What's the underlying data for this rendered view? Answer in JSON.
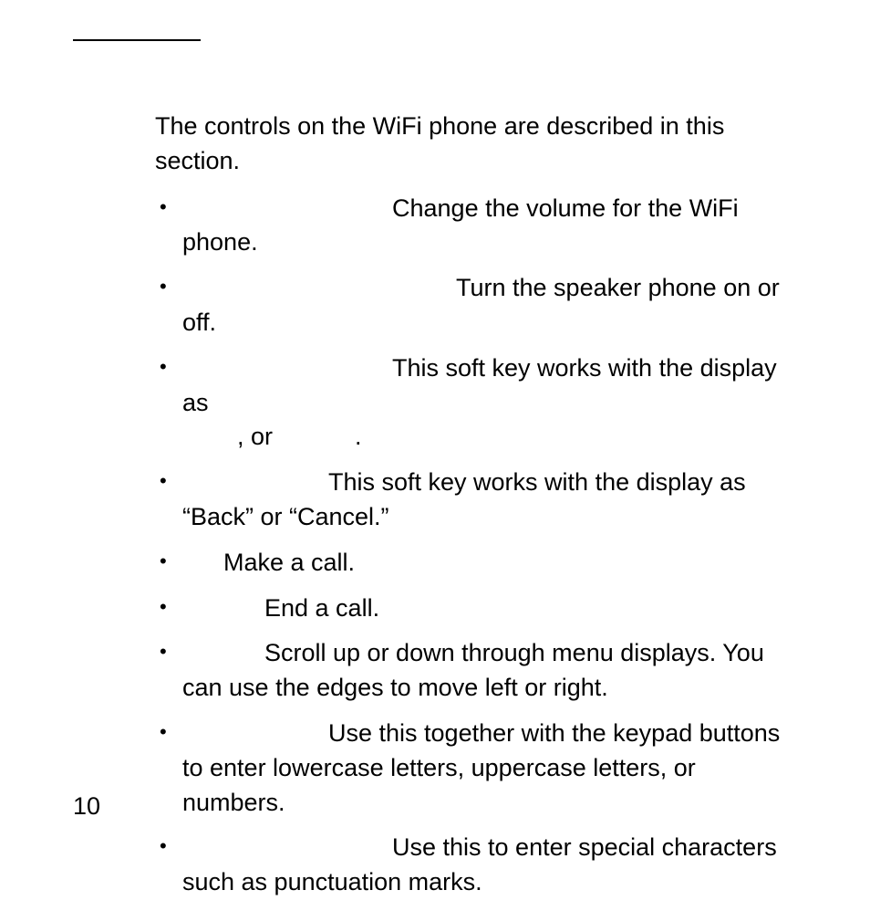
{
  "intro": "The controls on the WiFi phone are described in this section.",
  "items": {
    "volume": "Change the volume for the WiFi phone.",
    "speaker": "Turn the speaker phone on or off.",
    "soft1_a": "This soft key works with the display as",
    "soft1_b": ", or",
    "soft1_c": ".",
    "soft2": "This soft key works with the display as “Back” or “Cancel.”",
    "call": "Make a call.",
    "end": "End a call.",
    "scroll": "Scroll up or down through menu displays. You can use the edges to move left or right.",
    "keypad": "Use this together with the keypad buttons to enter lowercase letters, uppercase letters, or numbers.",
    "special": "Use this to enter special characters such as punctuation marks."
  },
  "page_number": "10"
}
